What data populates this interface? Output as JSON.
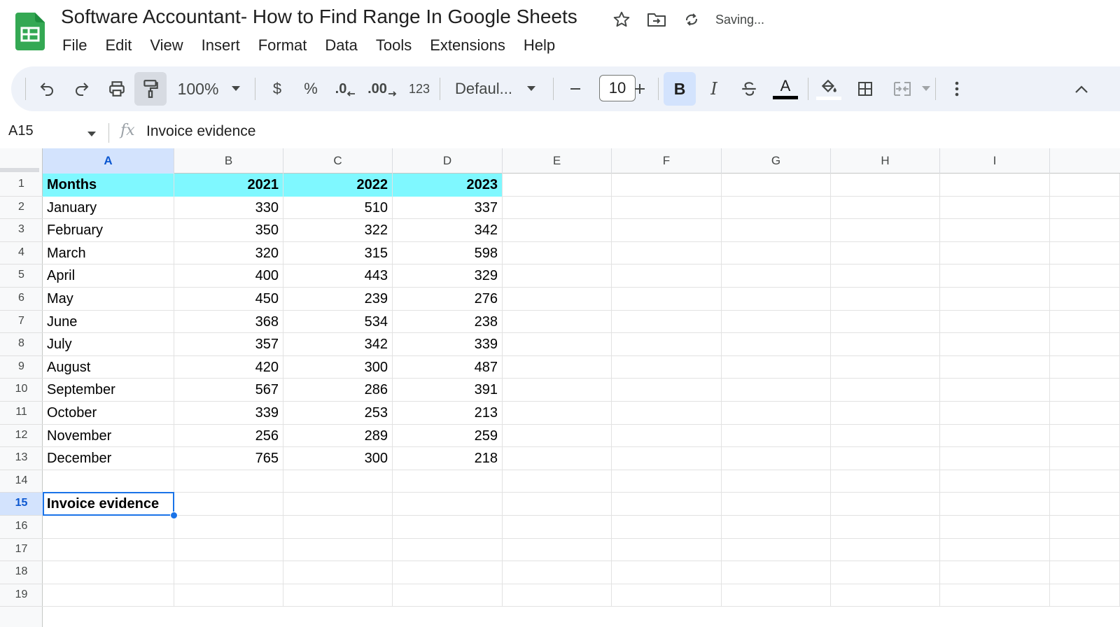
{
  "doc": {
    "title": "Software Accountant- How to Find Range In Google Sheets",
    "status": "Saving..."
  },
  "menu": [
    "File",
    "Edit",
    "View",
    "Insert",
    "Format",
    "Data",
    "Tools",
    "Extensions",
    "Help"
  ],
  "toolbar": {
    "zoom": "100%",
    "currency": "$",
    "percent": "%",
    "decrease_decimal": ".0",
    "increase_decimal": ".00",
    "number_format": "123",
    "font": "Defaul...",
    "font_size": "10",
    "bold": "B",
    "italic": "I",
    "text_color": "A",
    "icons": [
      "undo-icon",
      "redo-icon",
      "print-icon",
      "paint-format-icon",
      "strikethrough-icon",
      "fill-color-icon",
      "borders-icon",
      "merge-cells-icon",
      "more-options-icon",
      "collapse-toolbar-icon"
    ]
  },
  "formula_bar": {
    "name_box": "A15",
    "fx": "fx",
    "content": "Invoice evidence"
  },
  "grid": {
    "columns": [
      "A",
      "B",
      "C",
      "D",
      "E",
      "F",
      "G",
      "H",
      "I"
    ],
    "selected_column": "A",
    "selected_row": 15,
    "row_numbers": [
      "1",
      "2",
      "3",
      "4",
      "5",
      "6",
      "7",
      "8",
      "9",
      "10",
      "11",
      "12",
      "13",
      "14",
      "15",
      "16",
      "17",
      "18",
      "19"
    ],
    "header": [
      "Months",
      "2021",
      "2022",
      "2023"
    ],
    "rows": [
      [
        "January",
        "330",
        "510",
        "337"
      ],
      [
        "February",
        "350",
        "322",
        "342"
      ],
      [
        "March",
        "320",
        "315",
        "598"
      ],
      [
        "April",
        "400",
        "443",
        "329"
      ],
      [
        "May",
        "450",
        "239",
        "276"
      ],
      [
        "June",
        "368",
        "534",
        "238"
      ],
      [
        "July",
        "357",
        "342",
        "339"
      ],
      [
        "August",
        "420",
        "300",
        "487"
      ],
      [
        "September",
        "567",
        "286",
        "391"
      ],
      [
        "October",
        "339",
        "253",
        "213"
      ],
      [
        "November",
        "256",
        "289",
        "259"
      ],
      [
        "December",
        "765",
        "300",
        "218"
      ]
    ],
    "active_cell_value": "Invoice evidence",
    "header_fill": "#7ff8ff",
    "selection_color": "#1a73e8"
  }
}
